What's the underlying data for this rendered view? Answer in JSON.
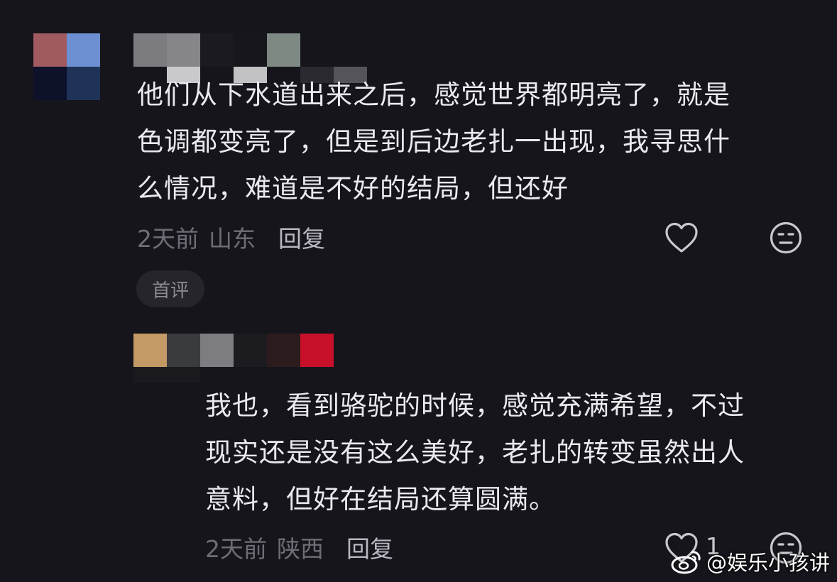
{
  "comment": {
    "text_lines": [
      "他们从下水道出来之后，感觉世界都明亮了，就是",
      "色调都变亮了，但是到后边老扎一出现，我寻思什",
      "么情况，难道是不好的结局，但还好"
    ],
    "time": "2天前",
    "location": "山东",
    "reply_label": "回复",
    "badge": "首评",
    "like_icon": "heart-icon",
    "dislike_icon": "meh-face-icon"
  },
  "reply": {
    "text_lines": [
      "我也，看到骆驼的时候，感觉充满希望，不过",
      "现实还是没有这么美好，老扎的转变虽然出人",
      "意料，但好在结局还算圆满。"
    ],
    "time": "2天前",
    "location": "陕西",
    "reply_label": "回复",
    "like_count": "1",
    "like_icon": "heart-icon",
    "dislike_icon": "meh-face-icon"
  },
  "watermark": {
    "text": "@娱乐小孩讲",
    "logo_icon": "weibo-logo-icon"
  },
  "colors": {
    "background": "#16151c",
    "text": "#eaeaee",
    "meta": "#6f6e76"
  }
}
